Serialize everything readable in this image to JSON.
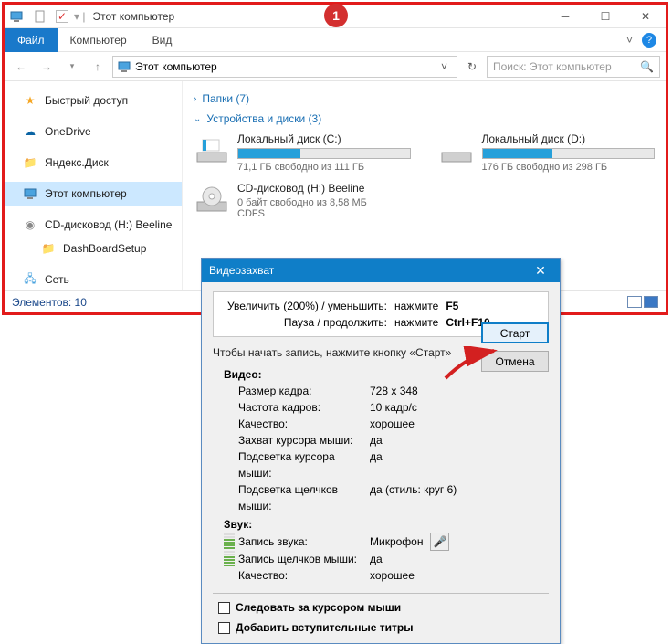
{
  "marker": "1",
  "window": {
    "title": "Этот компьютер",
    "tabs": {
      "file": "Файл",
      "computer": "Компьютер",
      "view": "Вид"
    },
    "address": "Этот компьютер",
    "search_placeholder": "Поиск: Этот компьютер",
    "sidebar": {
      "quick": "Быстрый доступ",
      "onedrive": "OneDrive",
      "yandex": "Яндекс.Диск",
      "thispc": "Этот компьютер",
      "cd": "CD-дисковод (H:) Beeline",
      "dash": "DashBoardSetup",
      "network": "Сеть"
    },
    "groups": {
      "folders": "Папки (7)",
      "devices": "Устройства и диски (3)"
    },
    "drives": [
      {
        "name": "Локальный диск (C:)",
        "free": "71,1 ГБ свободно из 111 ГБ",
        "fill": 36
      },
      {
        "name": "Локальный диск (D:)",
        "free": "176 ГБ свободно из 298 ГБ",
        "fill": 41
      }
    ],
    "cd": {
      "name": "CD-дисковод (H:) Beeline",
      "free": "0 байт свободно из 8,58 МБ",
      "fs": "CDFS"
    },
    "status": "Элементов: 10"
  },
  "dialog": {
    "title": "Видеозахват",
    "hint1_l": "Увеличить (200%) / уменьшить:",
    "hint1_k": "нажмите",
    "hint1_v": "F5",
    "hint2_l": "Пауза / продолжить:",
    "hint2_k": "нажмите",
    "hint2_v": "Ctrl+F10",
    "intro": "Чтобы начать запись, нажмите кнопку «Старт»",
    "start": "Старт",
    "cancel": "Отмена",
    "video_h": "Видео:",
    "rows": [
      {
        "l": "Размер кадра:",
        "v": "728 x 348"
      },
      {
        "l": "Частота кадров:",
        "v": "10 кадр/с"
      },
      {
        "l": "Качество:",
        "v": "хорошее"
      },
      {
        "l": "Захват курсора мыши:",
        "v": "да"
      },
      {
        "l": "Подсветка курсора мыши:",
        "v": "да"
      },
      {
        "l": "Подсветка щелчков мыши:",
        "v": "да  (стиль: круг 6)"
      }
    ],
    "audio_h": "Звук:",
    "arows": [
      {
        "l": "Запись звука:",
        "v": "Микрофон"
      },
      {
        "l": "Запись щелчков мыши:",
        "v": "да"
      },
      {
        "l": "Качество:",
        "v": "хорошее"
      }
    ],
    "chk1": "Следовать за курсором мыши",
    "chk2": "Добавить вступительные титры"
  }
}
